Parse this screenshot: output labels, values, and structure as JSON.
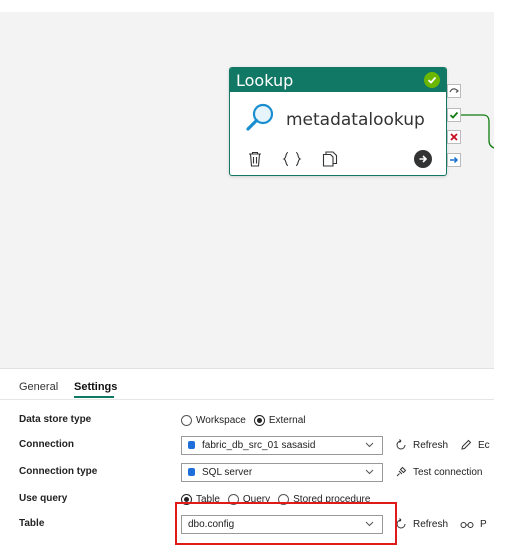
{
  "activity": {
    "type_title": "Lookup",
    "name": "metadatalookup"
  },
  "tabs": {
    "general": "General",
    "settings": "Settings"
  },
  "settings": {
    "data_store_type": {
      "label": "Data store type",
      "options": [
        "Workspace",
        "External"
      ],
      "selected": "External"
    },
    "connection": {
      "label": "Connection",
      "value": "fabric_db_src_01 sasasid",
      "refresh": "Refresh",
      "edit": "Ec"
    },
    "connection_type": {
      "label": "Connection type",
      "value": "SQL server",
      "test": "Test connection"
    },
    "use_query": {
      "label": "Use query",
      "options": [
        "Table",
        "Query",
        "Stored procedure"
      ],
      "selected": "Table"
    },
    "table": {
      "label": "Table",
      "value": "dbo.config",
      "refresh": "Refresh",
      "preview": "P"
    }
  },
  "colors": {
    "activity_accent": "#117865",
    "success": "#6bb700",
    "failure": "#c50f1f",
    "highlight": "#e01919"
  }
}
